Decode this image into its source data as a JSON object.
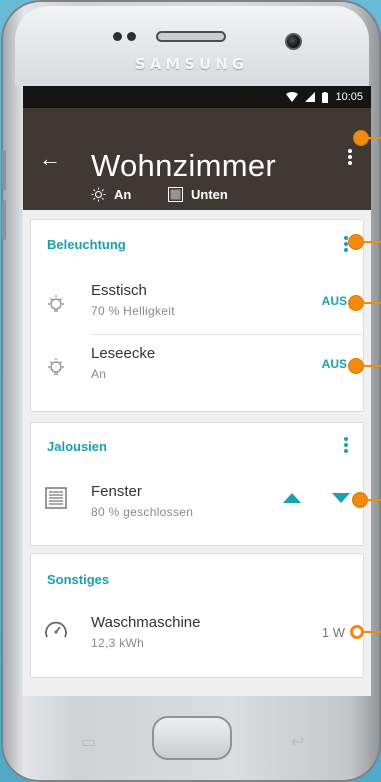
{
  "device": {
    "brand": "SAMSUNG"
  },
  "status_bar": {
    "time": "10:05"
  },
  "app_bar": {
    "title": "Wohnzimmer",
    "light_status": "An",
    "blind_status": "Unten"
  },
  "sections": [
    {
      "title": "Beleuchtung",
      "items": [
        {
          "name": "Esstisch",
          "detail": "70 % Helligkeit",
          "action": "AUS",
          "icon": "bulb-icon"
        },
        {
          "name": "Leseecke",
          "detail": "An",
          "action": "AUS",
          "icon": "bulb-icon"
        }
      ]
    },
    {
      "title": "Jalousien",
      "items": [
        {
          "name": "Fenster",
          "detail": "80 % geschlossen",
          "icon": "blind-icon"
        }
      ]
    },
    {
      "title": "Sonstiges",
      "items": [
        {
          "name": "Waschmaschine",
          "detail": "12,3 kWh",
          "value": "1 W",
          "icon": "gauge-icon"
        }
      ]
    }
  ],
  "colors": {
    "accent": "#1a9fb5",
    "appbar": "#3f3833",
    "hint": "#f28a10"
  }
}
